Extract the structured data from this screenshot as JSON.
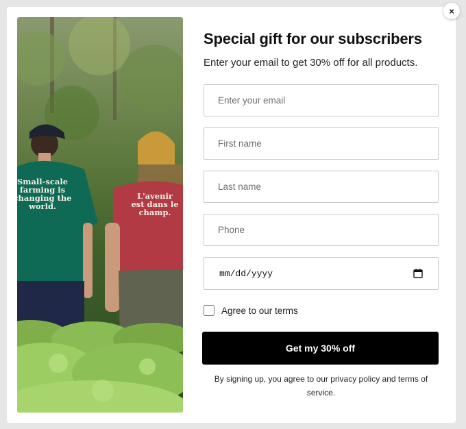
{
  "popup": {
    "close_label": "×",
    "title": "Special gift for our subscribers",
    "subtitle": "Enter your email to get 30% off for all products.",
    "fields": {
      "email": {
        "placeholder": "Enter your email",
        "value": ""
      },
      "first_name": {
        "placeholder": "First name",
        "value": ""
      },
      "last_name": {
        "placeholder": "Last name",
        "value": ""
      },
      "phone": {
        "placeholder": "Phone",
        "value": ""
      },
      "date": {
        "placeholder": "mm/dd/yyyy",
        "icon": "calendar-icon"
      }
    },
    "terms_label": "Agree to our terms",
    "terms_checked": false,
    "submit_label": "Get my 30% off",
    "disclaimer": "By signing up, you agree to our privacy policy and terms of service.",
    "colors": {
      "button": "#000000",
      "overlay": "#e6e6e6",
      "card": "#ffffff"
    }
  },
  "image": {
    "shirt_left_text": [
      "Small-scale",
      "farming is",
      "changing the",
      "world."
    ],
    "shirt_right_text": [
      "L'avenir",
      "est dans le",
      "champ."
    ]
  }
}
